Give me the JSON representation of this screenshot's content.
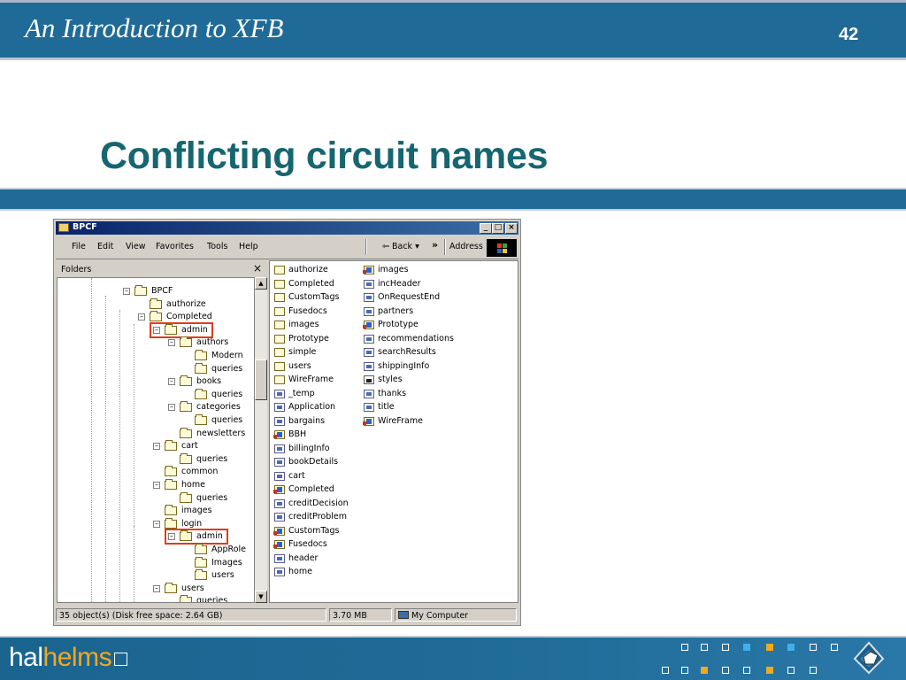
{
  "slide": {
    "header_title": "An Introduction to XFB",
    "page_number": "42",
    "title": "Conflicting circuit names",
    "logo_hal": "hal",
    "logo_helms": "helms"
  },
  "window": {
    "title": "BPCF",
    "menu": [
      "File",
      "Edit",
      "View",
      "Favorites",
      "Tools",
      "Help"
    ],
    "back_label": "Back",
    "address_label": "Address",
    "folders_label": "Folders"
  },
  "tree": [
    {
      "label": "BPCF",
      "expand": "minus"
    },
    {
      "label": "authorize",
      "expand": ""
    },
    {
      "label": "Completed",
      "expand": "minus"
    },
    {
      "label": "admin",
      "expand": "minus",
      "highlight": true
    },
    {
      "label": "authors",
      "expand": "minus"
    },
    {
      "label": "Modern",
      "expand": ""
    },
    {
      "label": "queries",
      "expand": ""
    },
    {
      "label": "books",
      "expand": "minus"
    },
    {
      "label": "queries",
      "expand": ""
    },
    {
      "label": "categories",
      "expand": "minus"
    },
    {
      "label": "queries",
      "expand": ""
    },
    {
      "label": "newsletters",
      "expand": ""
    },
    {
      "label": "cart",
      "expand": "minus"
    },
    {
      "label": "queries",
      "expand": ""
    },
    {
      "label": "common",
      "expand": ""
    },
    {
      "label": "home",
      "expand": "minus"
    },
    {
      "label": "queries",
      "expand": ""
    },
    {
      "label": "images",
      "expand": ""
    },
    {
      "label": "login",
      "expand": "minus"
    },
    {
      "label": "admin",
      "expand": "minus",
      "highlight": true
    },
    {
      "label": "AppRole",
      "expand": ""
    },
    {
      "label": "Images",
      "expand": ""
    },
    {
      "label": "users",
      "expand": ""
    },
    {
      "label": "users",
      "expand": "minus"
    },
    {
      "label": "queries",
      "expand": ""
    }
  ],
  "files_col1": [
    {
      "name": "authorize",
      "icon": "folder"
    },
    {
      "name": "Completed",
      "icon": "folder"
    },
    {
      "name": "CustomTags",
      "icon": "folder"
    },
    {
      "name": "Fusedocs",
      "icon": "folder"
    },
    {
      "name": "images",
      "icon": "folder"
    },
    {
      "name": "Prototype",
      "icon": "folder"
    },
    {
      "name": "simple",
      "icon": "folder"
    },
    {
      "name": "users",
      "icon": "folder"
    },
    {
      "name": "WireFrame",
      "icon": "folder"
    },
    {
      "name": "_temp",
      "icon": "doc"
    },
    {
      "name": "Application",
      "icon": "doc"
    },
    {
      "name": "bargains",
      "icon": "doc"
    },
    {
      "name": "BBH",
      "icon": "proj"
    },
    {
      "name": "billingInfo",
      "icon": "doc"
    },
    {
      "name": "bookDetails",
      "icon": "doc"
    },
    {
      "name": "cart",
      "icon": "doc"
    },
    {
      "name": "Completed",
      "icon": "proj"
    },
    {
      "name": "creditDecision",
      "icon": "doc"
    },
    {
      "name": "creditProblem",
      "icon": "doc"
    },
    {
      "name": "CustomTags",
      "icon": "proj"
    },
    {
      "name": "Fusedocs",
      "icon": "proj"
    },
    {
      "name": "header",
      "icon": "doc"
    },
    {
      "name": "home",
      "icon": "doc"
    }
  ],
  "files_col2": [
    {
      "name": "images",
      "icon": "proj"
    },
    {
      "name": "incHeader",
      "icon": "doc"
    },
    {
      "name": "OnRequestEnd",
      "icon": "doc"
    },
    {
      "name": "partners",
      "icon": "doc"
    },
    {
      "name": "Prototype",
      "icon": "proj"
    },
    {
      "name": "recommendations",
      "icon": "doc"
    },
    {
      "name": "searchResults",
      "icon": "doc"
    },
    {
      "name": "shippingInfo",
      "icon": "doc"
    },
    {
      "name": "styles",
      "icon": "img"
    },
    {
      "name": "thanks",
      "icon": "doc"
    },
    {
      "name": "title",
      "icon": "doc"
    },
    {
      "name": "WireFrame",
      "icon": "proj"
    }
  ],
  "status": {
    "objects": "35 object(s) (Disk free space: 2.64 GB)",
    "size": "3.70 MB",
    "location": "My Computer"
  }
}
